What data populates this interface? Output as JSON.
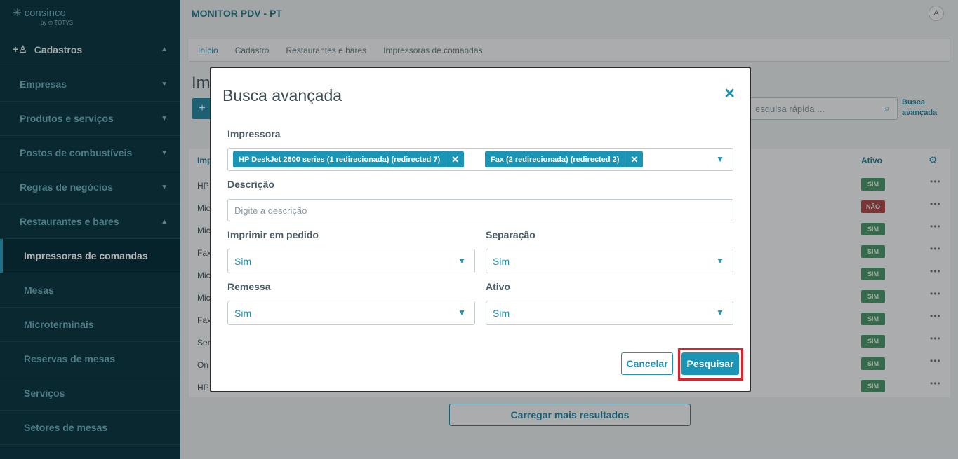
{
  "app": {
    "brand": "consinco",
    "brand_sub": "by ⊙ TOTVS",
    "title": "MONITOR PDV - PT",
    "avatar": "A"
  },
  "sidebar": {
    "section": "Cadastros",
    "items": [
      {
        "label": "Empresas"
      },
      {
        "label": "Produtos e serviços"
      },
      {
        "label": "Postos de combustíveis"
      },
      {
        "label": "Regras de negócios"
      },
      {
        "label": "Restaurantes e bares"
      }
    ],
    "subitems": [
      {
        "label": "Impressoras de comandas"
      },
      {
        "label": "Mesas"
      },
      {
        "label": "Microterminais"
      },
      {
        "label": "Reservas de mesas"
      },
      {
        "label": "Serviços"
      },
      {
        "label": "Setores de mesas"
      }
    ]
  },
  "breadcrumb": [
    "Início",
    "Cadastro",
    "Restaurantes e bares",
    "Impressoras de comandas"
  ],
  "page": {
    "title": "Im",
    "add": "+",
    "search_placeholder": "esquisa rápida ...",
    "advanced_link": "Busca avançada",
    "col_printer": "Imp",
    "col_active": "Ativo",
    "rows": [
      {
        "name": "HP",
        "active": "SIM"
      },
      {
        "name": "Mic",
        "active": "NÃO"
      },
      {
        "name": "Mic",
        "active": "SIM"
      },
      {
        "name": "Fax",
        "active": "SIM"
      },
      {
        "name": "Mic",
        "active": "SIM"
      },
      {
        "name": "Mic",
        "active": "SIM"
      },
      {
        "name": "Fax",
        "active": "SIM"
      },
      {
        "name": "Ser",
        "active": "SIM"
      },
      {
        "name": "On",
        "active": "SIM"
      },
      {
        "name": "HP",
        "active": "SIM"
      }
    ],
    "load_more": "Carregar mais resultados"
  },
  "modal": {
    "title": "Busca avançada",
    "printer_label": "Impressora",
    "printer_tags": [
      "HP DeskJet 2600 series (1 redirecionada) (redirected 7)",
      "Fax (2 redirecionada) (redirected 2)"
    ],
    "description_label": "Descrição",
    "description_placeholder": "Digite a descrição",
    "print_order_label": "Imprimir em pedido",
    "print_order_value": "Sim",
    "separation_label": "Separação",
    "separation_value": "Sim",
    "shipment_label": "Remessa",
    "shipment_value": "Sim",
    "active_label": "Ativo",
    "active_value": "Sim",
    "cancel": "Cancelar",
    "search": "Pesquisar"
  }
}
